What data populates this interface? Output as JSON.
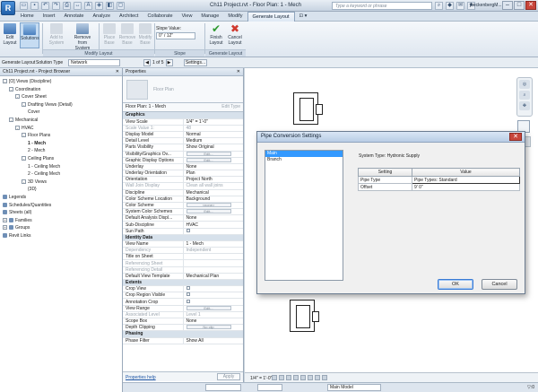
{
  "titlebar": {
    "logo": "R",
    "title": "Ch11 Project.rvt - Floor Plan: 1 - Mech",
    "search_placeholder": "Type a keyword or phrase",
    "user": "jbeckenbergM...",
    "qat_icons": [
      "open-icon",
      "save-icon",
      "undo-icon",
      "redo-icon",
      "print-icon",
      "measure-icon",
      "text-icon",
      "3d-icon",
      "sections-icon",
      "close-windows-icon"
    ]
  },
  "tabs": [
    "Home",
    "Insert",
    "Annotate",
    "Analyze",
    "Architect",
    "Collaborate",
    "View",
    "Manage",
    "Modify",
    "Generate Layout"
  ],
  "active_tab": "Generate Layout",
  "ribbon": {
    "edit_layout": "Edit Layout",
    "solutions": "Solutions",
    "add_to_system": "Add to System",
    "remove_from_system": "Remove from System",
    "place_base": "Place Base",
    "remove_base": "Remove Base",
    "modify_base": "Modify Base",
    "slope_value_label": "Slope Value:",
    "slope_value": "0\" / 12\"",
    "finish_layout": "Finish Layout",
    "cancel_layout": "Cancel Layout",
    "panel_modify_layout": "Modify Layout",
    "panel_slope": "Slope",
    "panel_generate_layout": "Generate Layout"
  },
  "optbar": {
    "mode": "Generate Layout",
    "solution_type_label": "Solution Type",
    "solution_type": "Network",
    "page": "1 of 5",
    "settings": "Settings..."
  },
  "browser": {
    "title": "Ch11 Project.rvt - Project Browser",
    "items": [
      {
        "label": "[O] Views (Discipline)",
        "indent": 0,
        "toggle": "-",
        "bold": false
      },
      {
        "label": "Coordination",
        "indent": 1,
        "toggle": "-",
        "bold": false
      },
      {
        "label": "Cover Sheet",
        "indent": 2,
        "toggle": "-",
        "bold": false
      },
      {
        "label": "Drafting Views (Detail)",
        "indent": 3,
        "toggle": "-",
        "bold": false
      },
      {
        "label": "Cover",
        "indent": 4,
        "toggle": "",
        "bold": false
      },
      {
        "label": "Mechanical",
        "indent": 1,
        "toggle": "-",
        "bold": false
      },
      {
        "label": "HVAC",
        "indent": 2,
        "toggle": "-",
        "bold": false
      },
      {
        "label": "Floor Plans",
        "indent": 3,
        "toggle": "-",
        "bold": false
      },
      {
        "label": "1 - Mech",
        "indent": 4,
        "toggle": "",
        "bold": true
      },
      {
        "label": "2 - Mech",
        "indent": 4,
        "toggle": "",
        "bold": false
      },
      {
        "label": "Ceiling Plans",
        "indent": 3,
        "toggle": "-",
        "bold": false
      },
      {
        "label": "1 - Ceiling Mech",
        "indent": 4,
        "toggle": "",
        "bold": false
      },
      {
        "label": "2 - Ceiling Mech",
        "indent": 4,
        "toggle": "",
        "bold": false
      },
      {
        "label": "3D Views",
        "indent": 3,
        "toggle": "-",
        "bold": false
      },
      {
        "label": "{3D}",
        "indent": 4,
        "toggle": "",
        "bold": false
      },
      {
        "label": "Legends",
        "indent": 0,
        "toggle": "",
        "bold": false,
        "icon": true
      },
      {
        "label": "Schedules/Quantities",
        "indent": 0,
        "toggle": "",
        "bold": false,
        "icon": true
      },
      {
        "label": "Sheets (all)",
        "indent": 0,
        "toggle": "",
        "bold": false,
        "icon": true
      },
      {
        "label": "Families",
        "indent": 0,
        "toggle": "+",
        "bold": false,
        "icon": true
      },
      {
        "label": "Groups",
        "indent": 0,
        "toggle": "+",
        "bold": false,
        "icon": true
      },
      {
        "label": "Revit Links",
        "indent": 0,
        "toggle": "",
        "bold": false,
        "icon": true
      }
    ]
  },
  "properties": {
    "title": "Properties",
    "type_name": "Floor Plan",
    "instance": "Floor Plan: 1 - Mech",
    "edit_type": "Edit Type",
    "rows": [
      {
        "k": "Graphics",
        "v": "",
        "group": true
      },
      {
        "k": "View Scale",
        "v": "1/4\" = 1'-0\""
      },
      {
        "k": "Scale Value 1:",
        "v": "48",
        "dim": true
      },
      {
        "k": "Display Model",
        "v": "Normal"
      },
      {
        "k": "Detail Level",
        "v": "Medium"
      },
      {
        "k": "Parts Visibility",
        "v": "Show Original"
      },
      {
        "k": "Visibility/Graphics Ov...",
        "v": "Edit...",
        "btn": true
      },
      {
        "k": "Graphic Display Options",
        "v": "Edit...",
        "btn": true
      },
      {
        "k": "Underlay",
        "v": "None"
      },
      {
        "k": "Underlay Orientation",
        "v": "Plan"
      },
      {
        "k": "Orientation",
        "v": "Project North"
      },
      {
        "k": "Wall Join Display",
        "v": "Clean all wall joins",
        "dim": true
      },
      {
        "k": "Discipline",
        "v": "Mechanical"
      },
      {
        "k": "Color Scheme Location",
        "v": "Background"
      },
      {
        "k": "Color Scheme",
        "v": "<none>",
        "btn": true
      },
      {
        "k": "System Color Schemes",
        "v": "Edit...",
        "btn": true
      },
      {
        "k": "Default Analysis Displ...",
        "v": "None"
      },
      {
        "k": "Sub-Discipline",
        "v": "HVAC"
      },
      {
        "k": "Sun Path",
        "v": "",
        "cb": true
      },
      {
        "k": "Identity Data",
        "v": "",
        "group": true
      },
      {
        "k": "View Name",
        "v": "1 - Mech"
      },
      {
        "k": "Dependency",
        "v": "Independent",
        "dim": true
      },
      {
        "k": "Title on Sheet",
        "v": ""
      },
      {
        "k": "Referencing Sheet",
        "v": "",
        "dim": true
      },
      {
        "k": "Referencing Detail",
        "v": "",
        "dim": true
      },
      {
        "k": "Default View Template",
        "v": "Mechanical Plan"
      },
      {
        "k": "Extents",
        "v": "",
        "group": true
      },
      {
        "k": "Crop View",
        "v": "",
        "cb": true
      },
      {
        "k": "Crop Region Visible",
        "v": "",
        "cb": true
      },
      {
        "k": "Annotation Crop",
        "v": "",
        "cb": true
      },
      {
        "k": "View Range",
        "v": "Edit...",
        "btn": true
      },
      {
        "k": "Associated Level",
        "v": "Level 1",
        "dim": true
      },
      {
        "k": "Scope Box",
        "v": "None"
      },
      {
        "k": "Depth Clipping",
        "v": "No clip",
        "btn": true
      },
      {
        "k": "Phasing",
        "v": "",
        "group": true
      },
      {
        "k": "Phase Filter",
        "v": "Show All"
      }
    ],
    "help_link": "Properties help",
    "apply": "Apply"
  },
  "dialog": {
    "title": "Pipe Conversion Settings",
    "list": [
      "Main",
      "Branch"
    ],
    "system_type": "System Type: Hydronic Supply",
    "col_setting": "Setting",
    "col_value": "Value",
    "rows": [
      {
        "setting": "Pipe Type",
        "value": "Pipe Types: Standard"
      },
      {
        "setting": "Offset",
        "value": "9'  0\""
      }
    ],
    "ok": "OK",
    "cancel": "Cancel",
    "close": "✕"
  },
  "viewbar": {
    "scale": "1/4\" = 1'-0\""
  },
  "status": {
    "field1": "",
    "field2": "",
    "model": "Main Model",
    "filter": ":0"
  },
  "colors": {
    "accent": "#3399ff",
    "ribbon_bg": "#dfe7f0",
    "close_red": "#c8453b"
  }
}
